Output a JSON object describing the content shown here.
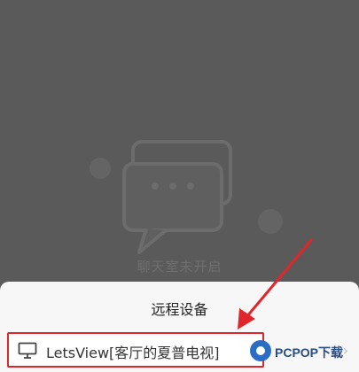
{
  "chat": {
    "empty_label": "聊天室未开启"
  },
  "sheet": {
    "title": "远程设备",
    "device_name": "LetsView[客厅的夏普电视]"
  },
  "watermark": {
    "text": "PCPOP下载"
  },
  "colors": {
    "overlay": "#5a5a5a",
    "highlight": "#e0262b",
    "sheet_bg": "#f7f7f7"
  }
}
